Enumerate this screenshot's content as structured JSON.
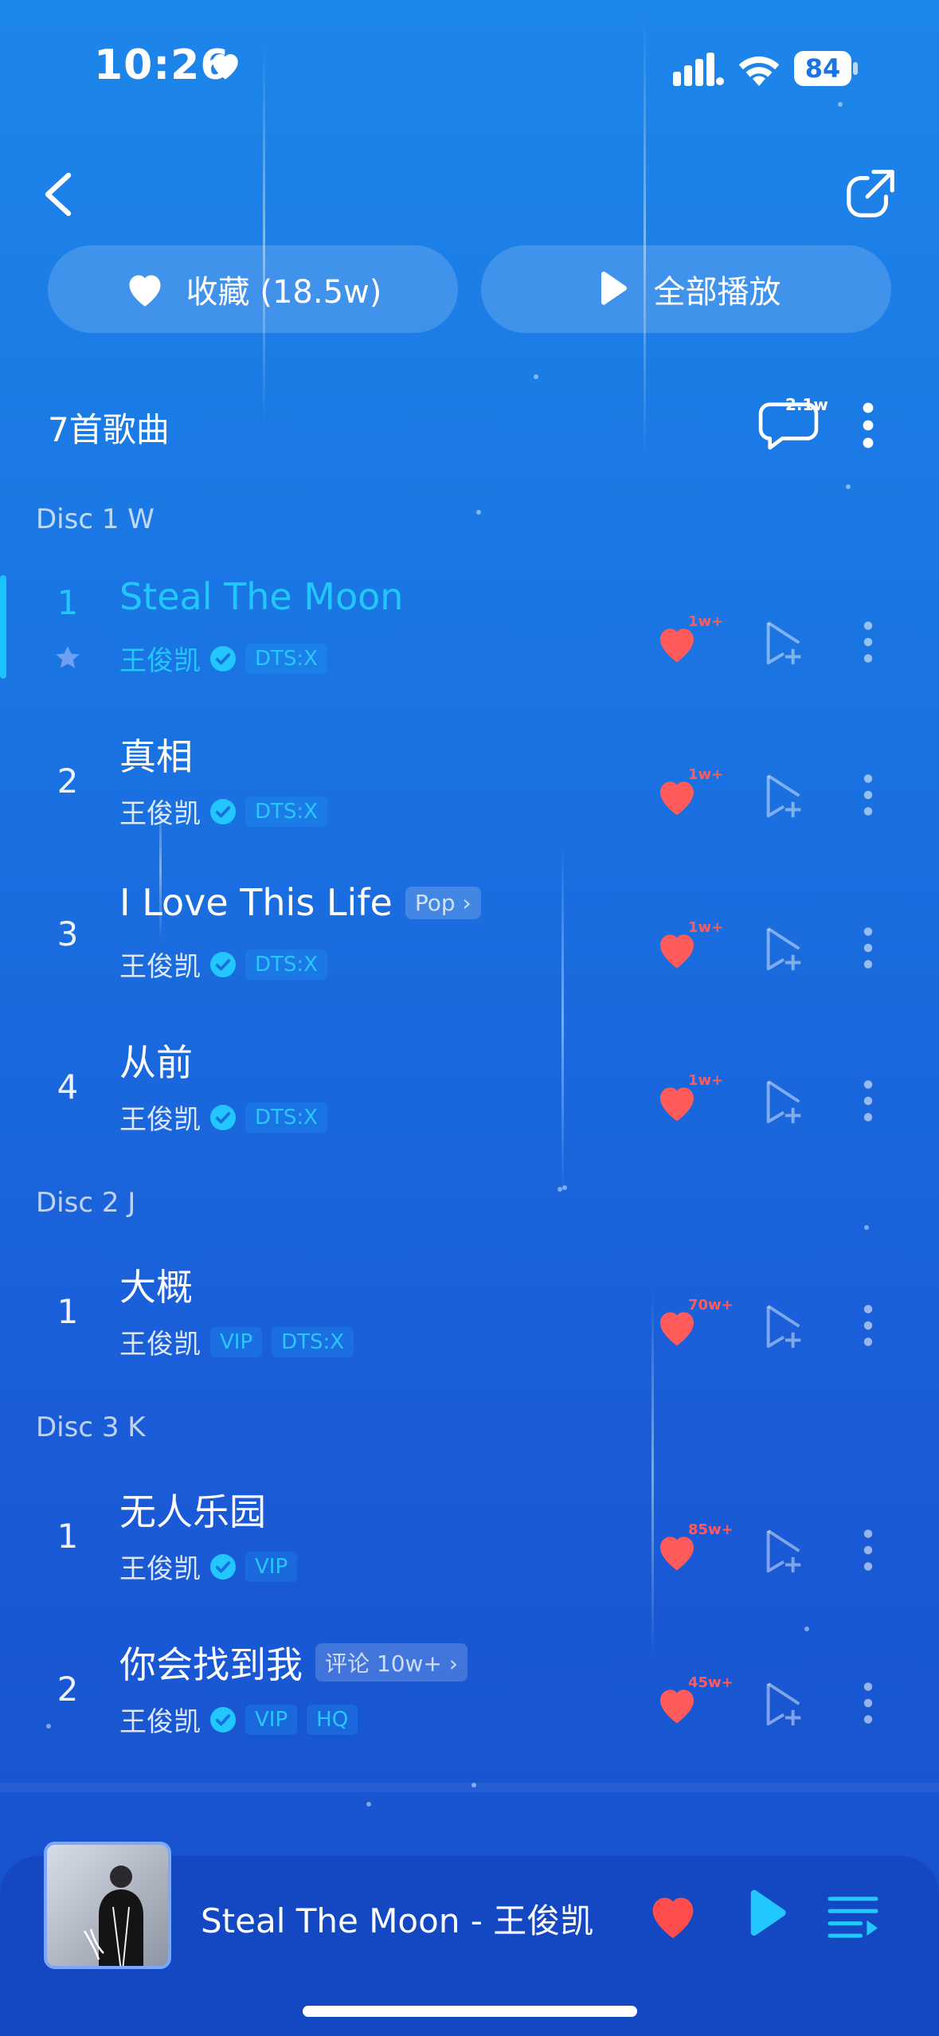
{
  "status_bar": {
    "time": "10:26",
    "battery": "84"
  },
  "actions": {
    "collect_label": "收藏 (18.5w)",
    "play_all_label": "全部播放"
  },
  "list_header": {
    "count_label": "7首歌曲",
    "comment_count": "2.1w"
  },
  "discs": [
    {
      "label": "Disc 1 W",
      "songs": [
        {
          "number": "1",
          "title": "Steal The Moon",
          "artist": "王俊凯",
          "tags": [
            "DTS:X"
          ],
          "likes": "1w+",
          "active": true
        },
        {
          "number": "2",
          "title": "真相",
          "artist": "王俊凯",
          "tags": [
            "DTS:X"
          ],
          "likes": "1w+"
        },
        {
          "number": "3",
          "title": "I Love This Life",
          "title_badge": "Pop",
          "artist": "王俊凯",
          "tags": [
            "DTS:X"
          ],
          "likes": "1w+"
        },
        {
          "number": "4",
          "title": "从前",
          "artist": "王俊凯",
          "tags": [
            "DTS:X"
          ],
          "likes": "1w+"
        }
      ]
    },
    {
      "label": "Disc 2 J",
      "songs": [
        {
          "number": "1",
          "title": "大概",
          "artist": "王俊凯",
          "tags": [
            "VIP",
            "DTS:X"
          ],
          "likes": "70w+"
        }
      ]
    },
    {
      "label": "Disc 3 K",
      "songs": [
        {
          "number": "1",
          "title": "无人乐园",
          "artist": "王俊凯",
          "tags": [
            "VIP"
          ],
          "likes": "85w+"
        },
        {
          "number": "2",
          "title": "你会找到我",
          "title_badge": "评论 10w+",
          "artist": "王俊凯",
          "tags": [
            "VIP",
            "HQ"
          ],
          "likes": "45w+"
        }
      ]
    }
  ],
  "player": {
    "now_playing": "Steal The Moon - 王俊凯"
  },
  "colors": {
    "accent": "#22c7ff",
    "like": "#ff5b5b",
    "background_top": "#1d86ea",
    "background_bottom": "#1750cc"
  },
  "icons": [
    "heart-icon",
    "signal-icon",
    "wifi-icon",
    "back-arrow-icon",
    "share-icon",
    "play-icon",
    "comment-icon",
    "more-icon",
    "star-icon",
    "verified-icon",
    "add-to-playlist-icon",
    "queue-icon"
  ]
}
